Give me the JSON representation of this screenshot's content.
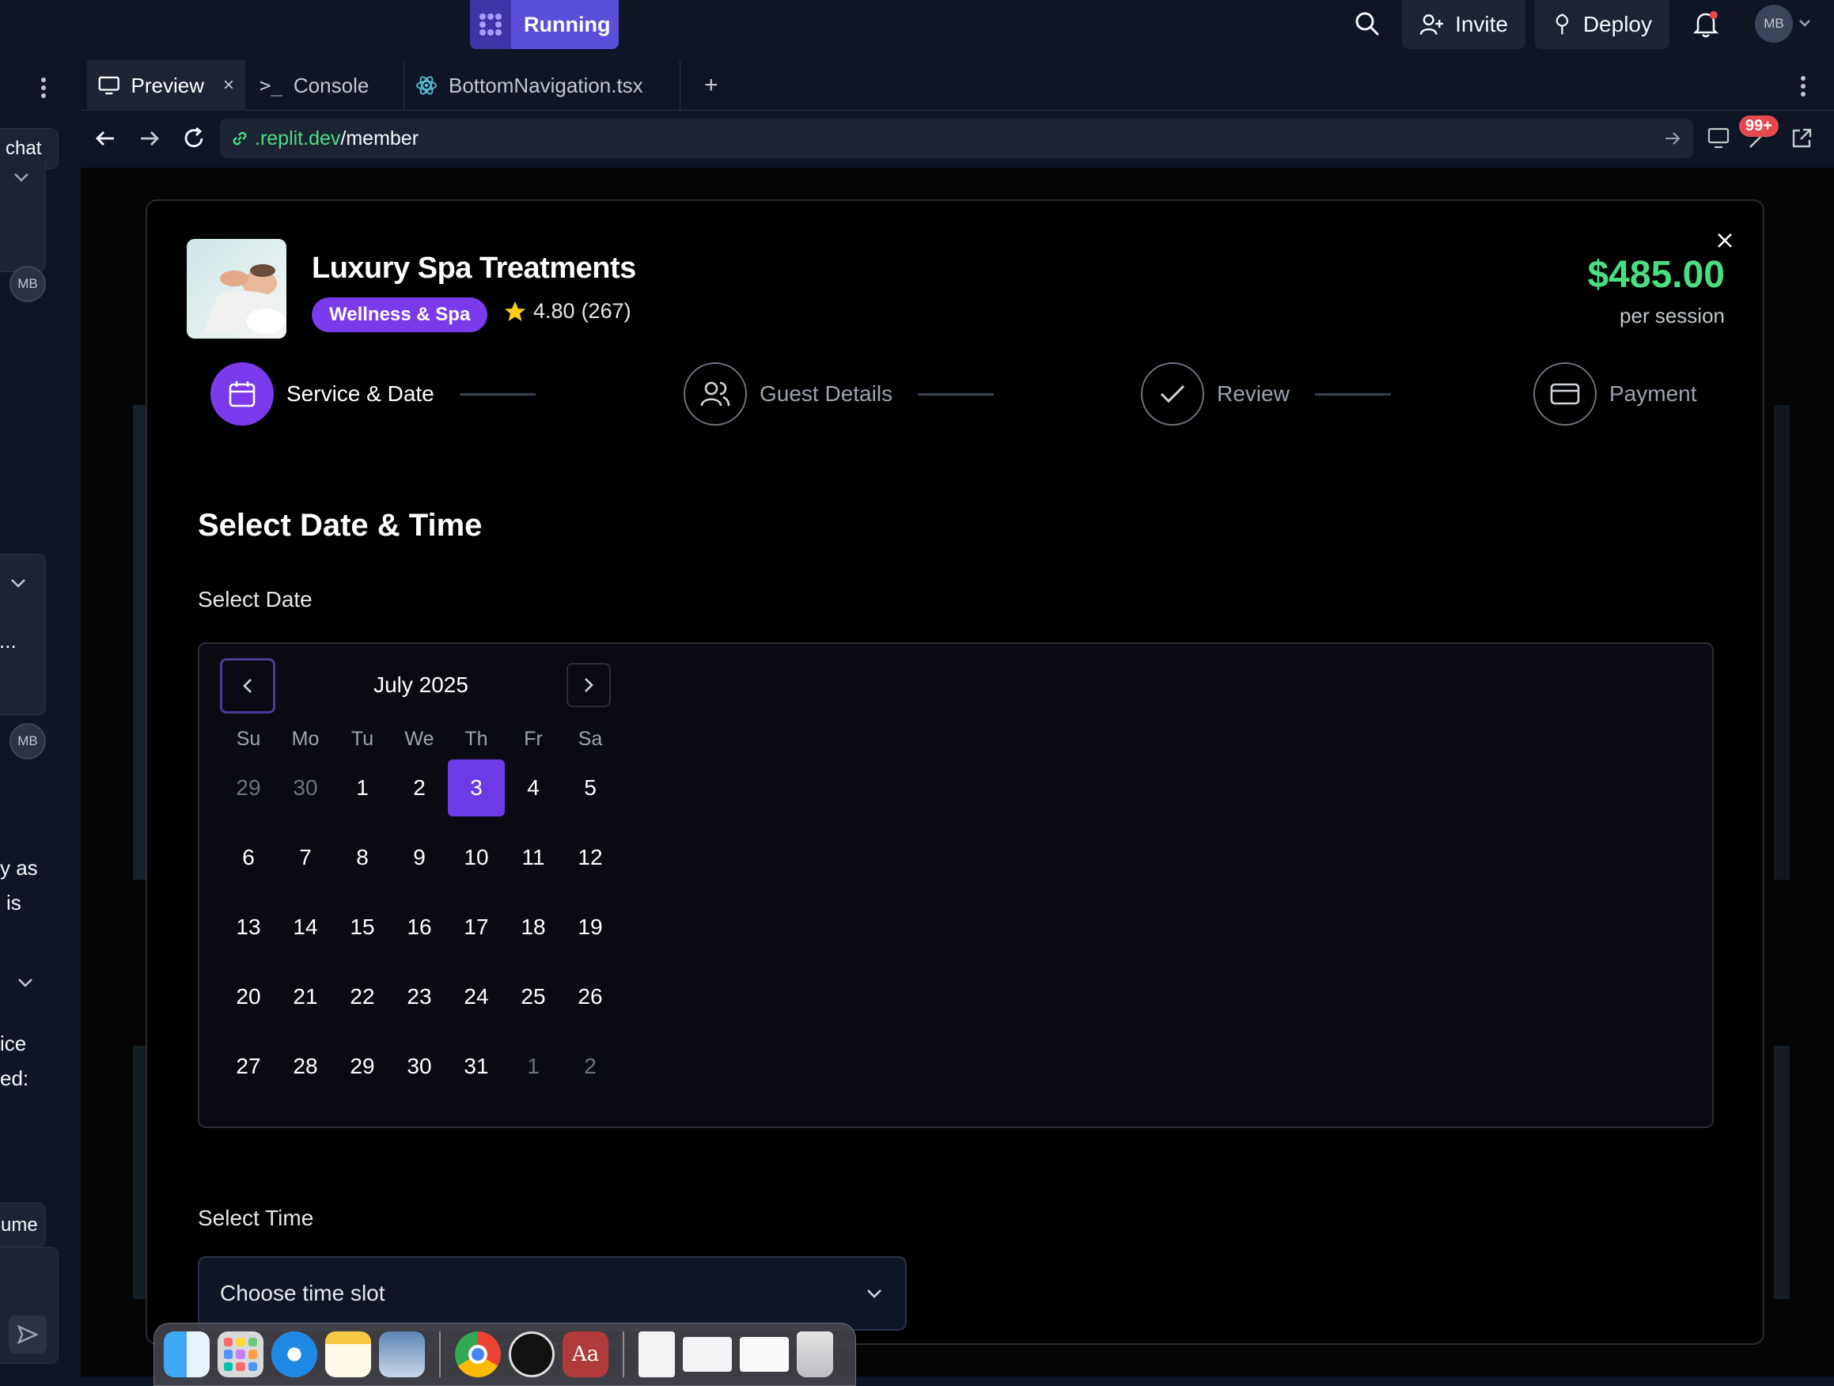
{
  "topbar": {
    "run_label": "Running",
    "invite_label": "Invite",
    "deploy_label": "Deploy",
    "avatar_initials": "MB"
  },
  "left_panel": {
    "chat_fragment": "chat",
    "ellipsis": "...",
    "avatar1": "MB",
    "avatar2": "MB",
    "text_line1": "y as",
    "text_line2": "is",
    "text_line3": "ice",
    "text_line4": "ed:",
    "resume_fragment": "ume"
  },
  "tabs": [
    {
      "label": "Preview"
    },
    {
      "label": "Console"
    },
    {
      "label": "BottomNavigation.tsx"
    }
  ],
  "url": {
    "domain": ".replit.dev",
    "path": "/member",
    "badge": "99+"
  },
  "modal": {
    "title": "Luxury Spa Treatments",
    "category": "Wellness & Spa",
    "rating": "4.80",
    "reviews": "(267)",
    "price": "$485.00",
    "price_unit": "per session",
    "steps": [
      {
        "label": "Service & Date"
      },
      {
        "label": "Guest Details"
      },
      {
        "label": "Review"
      },
      {
        "label": "Payment"
      }
    ],
    "section_title": "Select Date & Time",
    "date_label": "Select Date",
    "time_label": "Select Time",
    "time_placeholder": "Choose time slot"
  },
  "calendar": {
    "month": "July 2025",
    "weekdays": [
      "Su",
      "Mo",
      "Tu",
      "We",
      "Th",
      "Fr",
      "Sa"
    ],
    "weeks": [
      [
        "29",
        "30",
        "1",
        "2",
        "3",
        "4",
        "5"
      ],
      [
        "6",
        "7",
        "8",
        "9",
        "10",
        "11",
        "12"
      ],
      [
        "13",
        "14",
        "15",
        "16",
        "17",
        "18",
        "19"
      ],
      [
        "20",
        "21",
        "22",
        "23",
        "24",
        "25",
        "26"
      ],
      [
        "27",
        "28",
        "29",
        "30",
        "31",
        "1",
        "2"
      ]
    ],
    "selected": "3",
    "accent": "#6d3be6"
  },
  "colors": {
    "accent_purple": "#7c3aed",
    "price_green": "#4ade80",
    "run_button": "#5a4fd9"
  }
}
